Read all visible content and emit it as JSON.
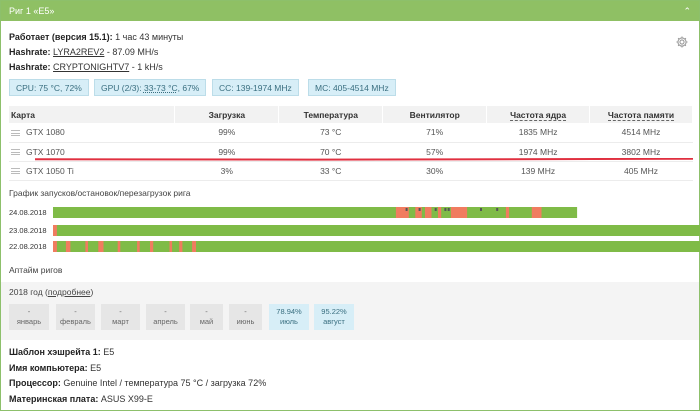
{
  "header": {
    "title": "Риг 1 «E5»",
    "chevron": "⌃"
  },
  "info": {
    "uptime_label": "Работает (версия 15.1):",
    "uptime_value": "1 час 43 минуты",
    "hashrate1_label": "Hashrate:",
    "hashrate1_algo": "LYRA2REV2",
    "hashrate1_value": "- 87.09 MH/s",
    "hashrate2_label": "Hashrate:",
    "hashrate2_algo": "CRYPTONIGHTV7",
    "hashrate2_value": "- 1 kH/s"
  },
  "badges": {
    "cpu": "CPU: 75 °C, 72%",
    "gpu_prefix": "GPU (2/3): ",
    "gpu_temp": "33-73 °C",
    "gpu_suffix": ", 67%",
    "cc": "CC: 139-1974 MHz",
    "mc": "MC: 405-4514 MHz"
  },
  "table": {
    "headers": [
      "Карта",
      "Загрузка",
      "Температура",
      "Вентилятор",
      "Частота ядра",
      "Частота памяти"
    ],
    "rows": [
      [
        "GTX 1080",
        "99%",
        "73 °C",
        "71%",
        "1835 MHz",
        "4514 MHz"
      ],
      [
        "GTX 1070",
        "99%",
        "70 °C",
        "57%",
        "1974 MHz",
        "3802 MHz"
      ],
      [
        "GTX 1050 Ti",
        "3%",
        "33 °C",
        "30%",
        "139 MHz",
        "405 MHz"
      ]
    ]
  },
  "chart_title": "График запусков/остановок/перезагрузок рига",
  "chart_data": {
    "type": "timeline",
    "rows": [
      {
        "date": "24.08.2018",
        "end": 0.81,
        "red_spans": [
          [
            0.53,
            0.55
          ],
          [
            0.56,
            0.57
          ],
          [
            0.575,
            0.585
          ],
          [
            0.595,
            0.6
          ],
          [
            0.615,
            0.64
          ],
          [
            0.7,
            0.705
          ],
          [
            0.74,
            0.755
          ]
        ],
        "dark_marks": [
          0.545,
          0.565,
          0.59,
          0.605,
          0.61,
          0.66,
          0.685
        ]
      },
      {
        "date": "23.08.2018",
        "end": 1.0,
        "red_spans": [
          [
            0.0,
            0.006
          ]
        ],
        "dark_marks": []
      },
      {
        "date": "22.08.2018",
        "end": 1.0,
        "red_spans": [
          [
            0.0,
            0.006
          ],
          [
            0.02,
            0.027
          ],
          [
            0.05,
            0.054
          ],
          [
            0.07,
            0.078
          ],
          [
            0.1,
            0.104
          ],
          [
            0.13,
            0.134
          ],
          [
            0.15,
            0.155
          ],
          [
            0.18,
            0.184
          ],
          [
            0.195,
            0.2
          ],
          [
            0.215,
            0.221
          ]
        ],
        "dark_marks": []
      }
    ],
    "colors": {
      "ok": "#7fbb47",
      "restart": "#f07c60",
      "dark": "#555555"
    }
  },
  "uptime_title": "Аптайм ригов",
  "months_box": {
    "year_prefix": "2018 год (",
    "year_link": "подробнее",
    "year_suffix": ")",
    "months": [
      {
        "value": "-",
        "name": "январь",
        "level": null
      },
      {
        "value": "-",
        "name": "февраль",
        "level": null
      },
      {
        "value": "-",
        "name": "март",
        "level": null
      },
      {
        "value": "-",
        "name": "апрель",
        "level": null
      },
      {
        "value": "-",
        "name": "май",
        "level": null
      },
      {
        "value": "-",
        "name": "июнь",
        "level": null
      },
      {
        "value": "78.94%",
        "name": "июль",
        "level": 78.94
      },
      {
        "value": "95.22%",
        "name": "август",
        "level": 95.22
      }
    ]
  },
  "footer": {
    "template_label": "Шаблон хэшрейта 1:",
    "template_value": "E5",
    "hostname_label": "Имя компьютера:",
    "hostname_value": "E5",
    "cpu_label": "Процессор:",
    "cpu_value": "Genuine Intel / температура 75 °C / загрузка 72%",
    "mb_label": "Материнская плата:",
    "mb_value": "ASUS X99-E"
  },
  "icons": {
    "settings": "gear-icon",
    "collapse": "chevron-up-icon",
    "drag": "drag-handle-icon"
  },
  "colors": {
    "header": "#8fc064",
    "badge_bg": "#d7eef7",
    "highlight_line": "#e03040"
  }
}
